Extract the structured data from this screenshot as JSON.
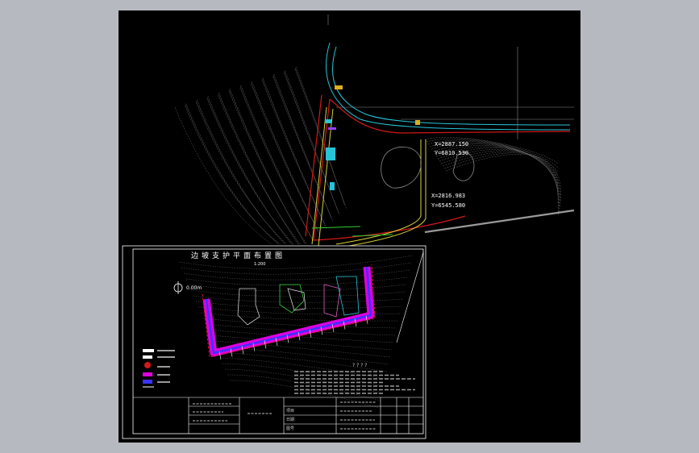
{
  "colors": {
    "background": "#b7b9c0",
    "canvas": "#000000",
    "contour": "#6a6a6a",
    "road_yellow": "#d8d23a",
    "road_red": "#d41818",
    "road_cyan": "#27c3d6",
    "wall_magenta": "#e000e0",
    "wall_blue": "#3a32ff",
    "frame": "#ffffff",
    "label": "#ffffff"
  },
  "coords": {
    "p1_x": "X=2887.150",
    "p1_y": "Y=6810.530",
    "p2_x": "X=2816.983",
    "p2_y": "Y=6545.580"
  },
  "inset": {
    "title": "边坡支护平面布置图",
    "scale": "1:200",
    "north_label": "0.00m",
    "table_rows": [
      "项目",
      "日期",
      "图号"
    ],
    "stamp_text": "? ? ? ?"
  }
}
